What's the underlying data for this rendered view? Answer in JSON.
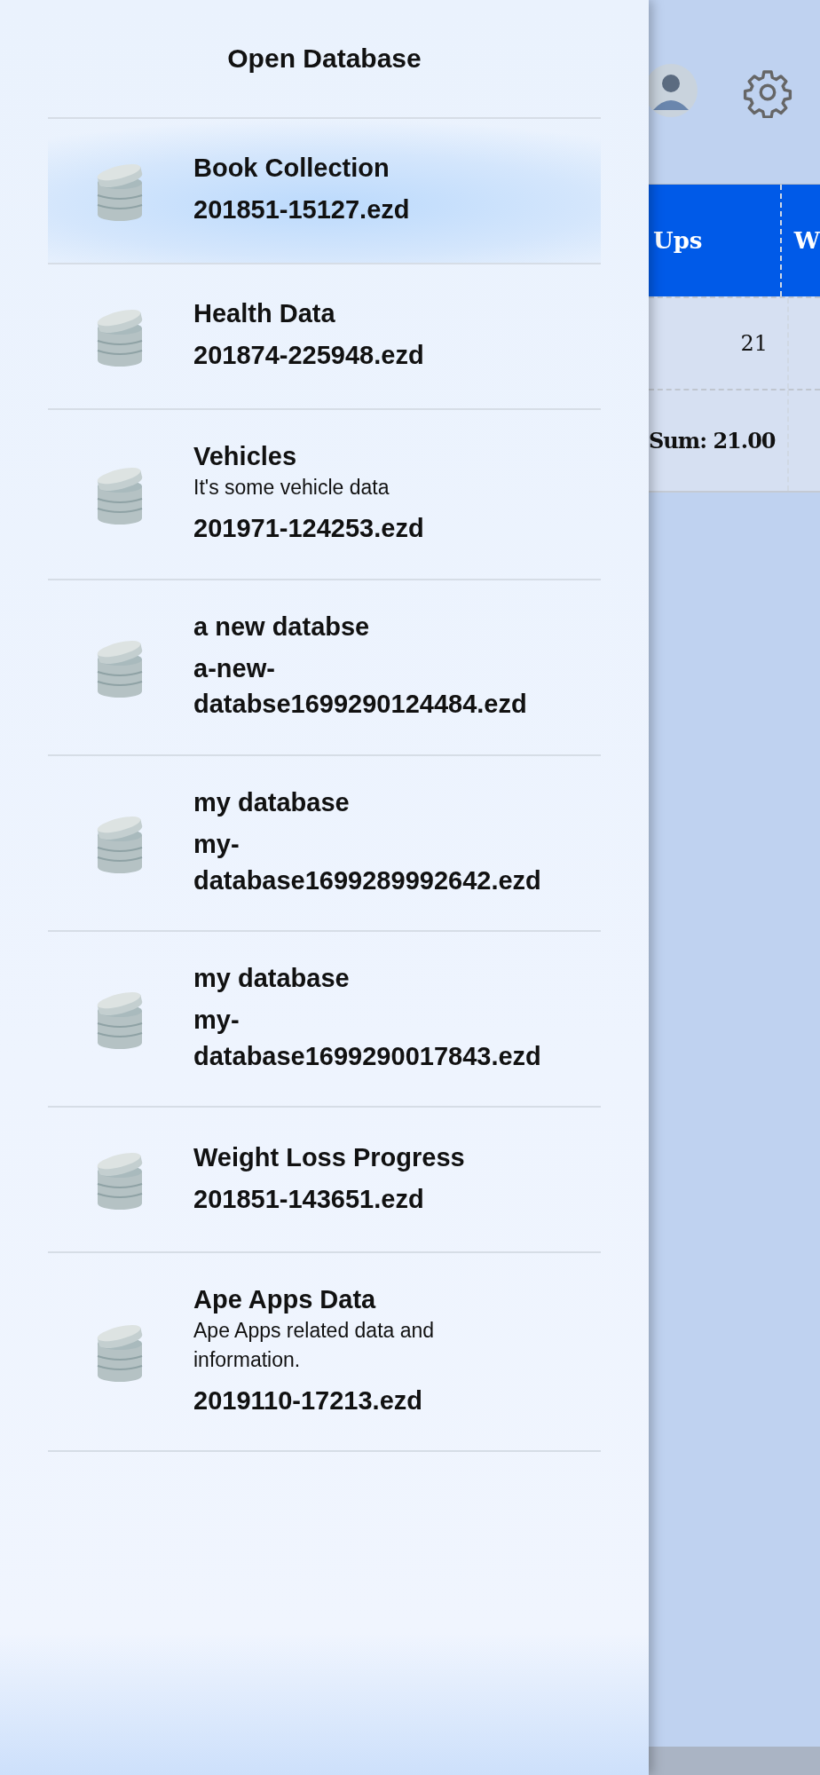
{
  "drawer": {
    "title": "Open Database",
    "databases": [
      {
        "name": "Book Collection",
        "file": "201851-15127.ezd",
        "selected": true
      },
      {
        "name": "Health Data",
        "file": "201874-225948.ezd",
        "selected": false
      },
      {
        "name": "Vehicles",
        "description": "It's some vehicle data",
        "file": "201971-124253.ezd",
        "selected": false
      },
      {
        "name": "a new databse",
        "file": "a-new-databse1699290124484.ezd",
        "selected": false
      },
      {
        "name": "my database",
        "file": "my-database1699289992642.ezd",
        "selected": false
      },
      {
        "name": "my database",
        "file": "my-database1699290017843.ezd",
        "selected": false
      },
      {
        "name": "Weight Loss Progress",
        "file": "201851-143651.ezd",
        "selected": false
      },
      {
        "name": "Ape Apps Data",
        "description": "Ape Apps related data and information.",
        "file": "2019110-17213.ezd",
        "selected": false
      }
    ]
  },
  "table": {
    "columns": [
      "Ups",
      "W"
    ],
    "rows": [
      [
        "21"
      ]
    ],
    "footer": [
      "Sum: 21.00"
    ]
  }
}
